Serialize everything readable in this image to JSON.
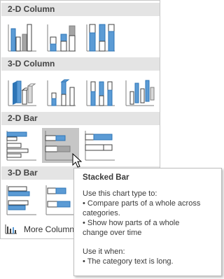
{
  "sections": [
    {
      "label": "2-D Column"
    },
    {
      "label": "3-D Column"
    },
    {
      "label": "2-D Bar"
    },
    {
      "label": "3-D Bar"
    }
  ],
  "more_link": {
    "label": "More Column Charts...",
    "visible_label": "More Column"
  },
  "tooltip": {
    "title": "Stacked Bar",
    "use_heading": "Use this chart type to:",
    "use_lines": [
      "• Compare parts of a whole across",
      "categories.",
      "• Show how parts of a whole",
      "change over time"
    ],
    "when_heading": "Use it when:",
    "when_lines": [
      "• The category text is long."
    ]
  },
  "colors": {
    "accent_blue": "#5b9bd5",
    "accent_blue_dark": "#2e75b6",
    "gray": "#a5a5a5",
    "selected": "#c6c6c6",
    "header_bg": "#e4e4e4"
  },
  "selected_item": "2-D Bar / Stacked Bar"
}
